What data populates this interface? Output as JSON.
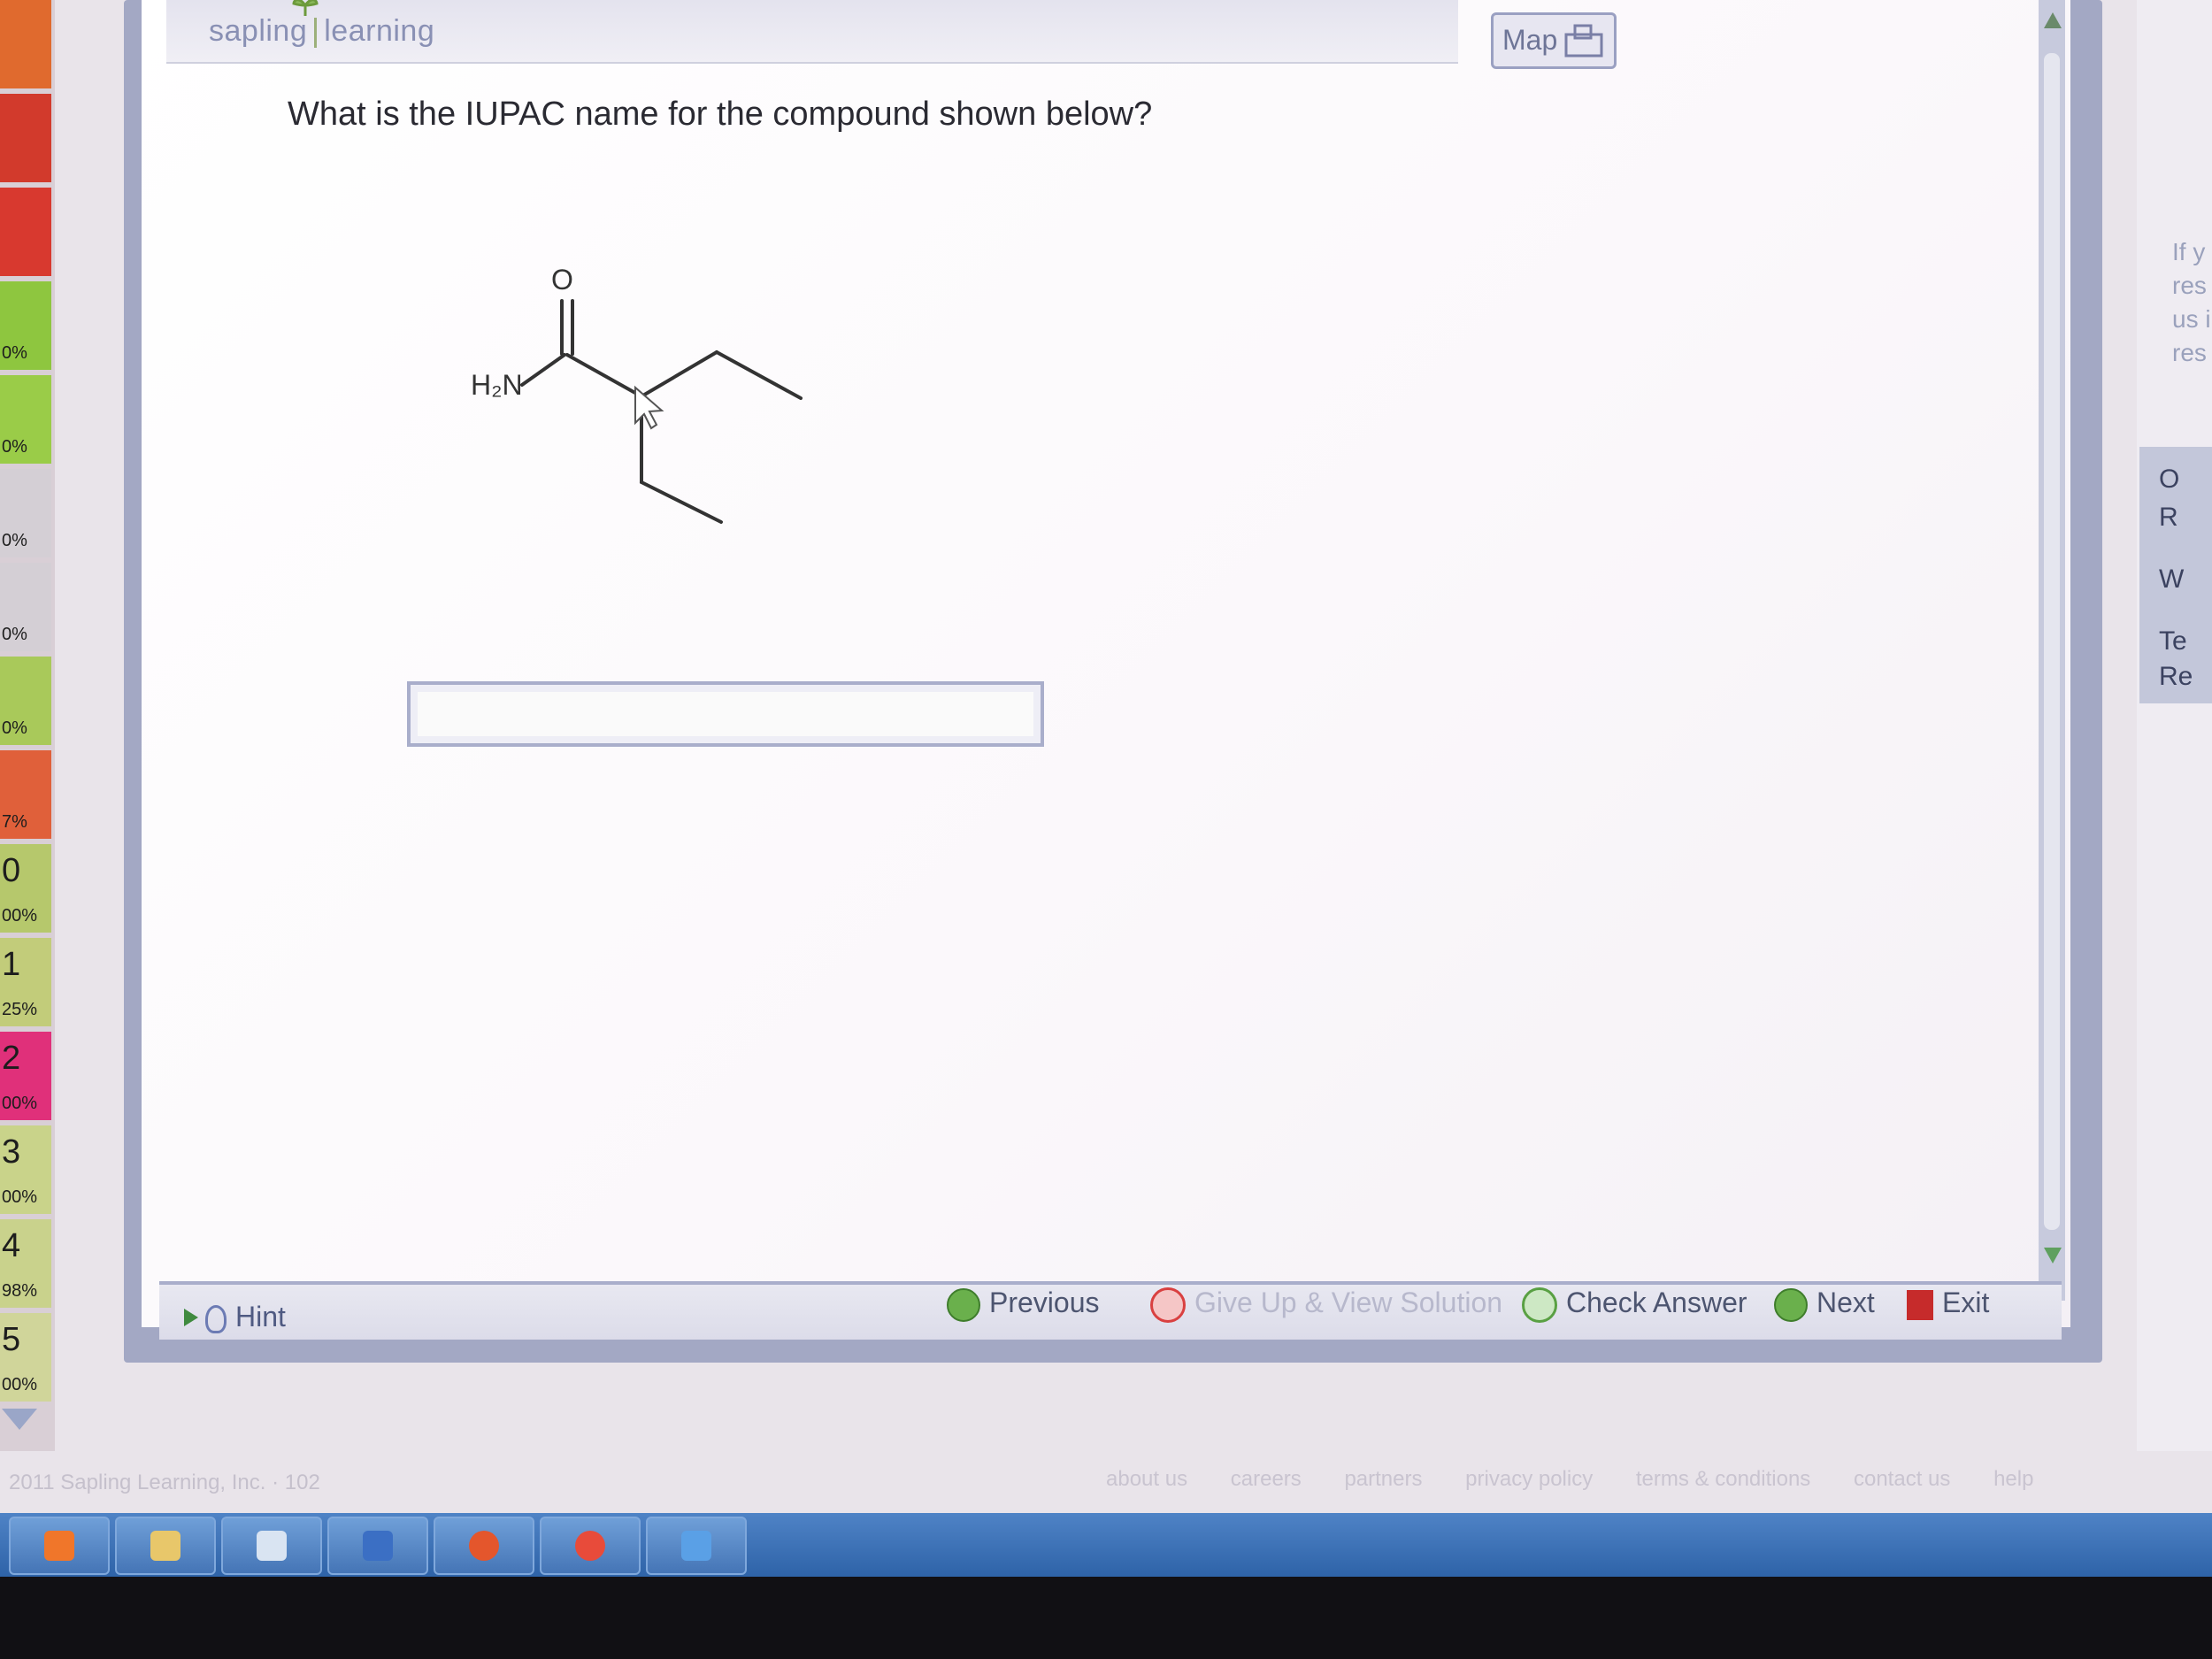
{
  "app": {
    "logo_text_left": "sapling",
    "logo_text_right": "learning",
    "map_label": "Map"
  },
  "question": {
    "text": "What is the IUPAC name for the compound shown below?",
    "molecule_labels": {
      "oxygen": "O",
      "amine": "H₂N"
    },
    "answer_value": "",
    "answer_placeholder": ""
  },
  "score_strip": {
    "tiles": [
      {
        "num": "",
        "pct": "",
        "color": "#e06a2e"
      },
      {
        "num": "",
        "pct": "",
        "color": "#d23a2c"
      },
      {
        "num": "",
        "pct": "",
        "color": "#d8392f"
      },
      {
        "num": "",
        "pct": "0%",
        "color": "#8ec63f"
      },
      {
        "num": "",
        "pct": "0%",
        "color": "#9acc48"
      },
      {
        "num": "",
        "pct": "0%",
        "color": "#d4cfd5"
      },
      {
        "num": "",
        "pct": "0%",
        "color": "#d4cfd5"
      },
      {
        "num": "",
        "pct": "0%",
        "color": "#a9c95a"
      },
      {
        "num": "",
        "pct": "7%",
        "color": "#e0603a"
      },
      {
        "num": "0",
        "pct": "00%",
        "color": "#b6c86c"
      },
      {
        "num": "1",
        "pct": "25%",
        "color": "#c2cc7a"
      },
      {
        "num": "2",
        "pct": "00%",
        "color": "#e0307a"
      },
      {
        "num": "3",
        "pct": "00%",
        "color": "#c9d38a"
      },
      {
        "num": "4",
        "pct": "98%",
        "color": "#c9d28c"
      },
      {
        "num": "5",
        "pct": "00%",
        "color": "#d0d59a"
      }
    ]
  },
  "bottom_bar": {
    "hint_label": "Hint",
    "previous_label": "Previous",
    "giveup_label": "Give Up & View Solution",
    "check_label": "Check Answer",
    "next_label": "Next",
    "exit_label": "Exit"
  },
  "footer": {
    "copyright": "2011 Sapling Learning, Inc. · 102",
    "links": [
      "about us",
      "careers",
      "partners",
      "privacy policy",
      "terms & conditions",
      "contact us",
      "help"
    ]
  },
  "side_panel": {
    "text_lines": [
      "If y",
      "res",
      "us i",
      "res"
    ],
    "items": [
      "O",
      "R",
      "W",
      "Te",
      "Re"
    ]
  },
  "taskbar": {
    "apps": [
      {
        "name": "orange-app-icon",
        "color": "#f0762a"
      },
      {
        "name": "folder-icon",
        "color": "#e8c76a"
      },
      {
        "name": "paint-icon",
        "color": "#d9e4f2"
      },
      {
        "name": "word-icon",
        "color": "#3b6fc4"
      },
      {
        "name": "firefox-icon",
        "color": "#e4562c"
      },
      {
        "name": "chrome-icon",
        "color": "#e84b3a"
      },
      {
        "name": "ie-icon",
        "color": "#5aa0e6"
      }
    ]
  }
}
